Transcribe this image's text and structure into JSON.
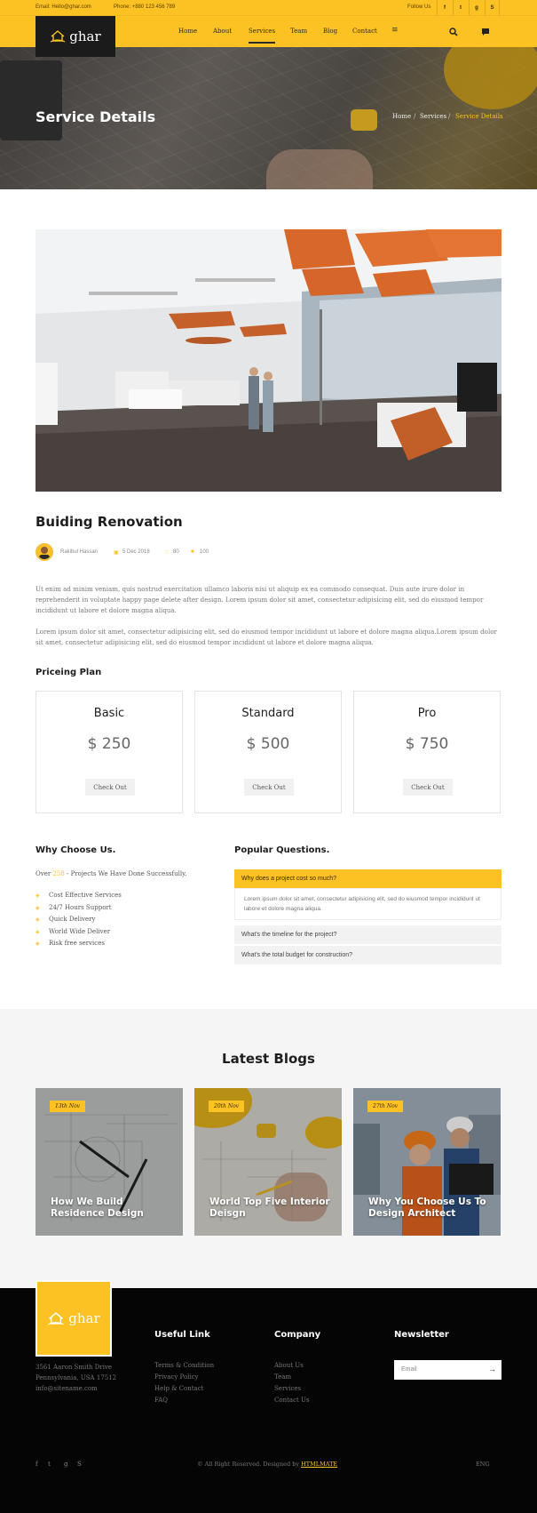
{
  "topbar": {
    "email": "Email: Hello@ghar.com",
    "phone": "Phone: +880 123 456 789",
    "follow": "Follow Us",
    "social": [
      {
        "icon": "facebook-icon",
        "glyph": "f"
      },
      {
        "icon": "twitter-icon",
        "glyph": "t"
      },
      {
        "icon": "google-plus-icon",
        "glyph": "g"
      },
      {
        "icon": "skype-icon",
        "glyph": "S"
      }
    ]
  },
  "nav": {
    "logo": "ghar",
    "items": [
      "Home",
      "About",
      "Services",
      "Team",
      "Blog",
      "Contact"
    ],
    "active": "Services",
    "menu_icon": "≡"
  },
  "hero": {
    "title": "Service Details",
    "breadcrumb": [
      "Home",
      "Services",
      "Service Details"
    ]
  },
  "article": {
    "title": "Buiding Renovation",
    "author": "Rakibul Hassan",
    "date": "5 Dec 2018",
    "likes": "80",
    "comments": "100",
    "para1": "Ut enim ad minim veniam, quis nostrud exercitation ullamco laboris nisi ut aliquip ex ea commodo consequat. Duis aute irure dolor in reprehenderit in voluptate happy page delete after design. Lorem ipsum dolor sit amet, consectetur adipisicing elit, sed do eiusmod tempor incididunt ut labore et dolore magna aliqua.",
    "para2": "Lorem ipsum dolor sit amet, consectetur adipisicing elit, sed do eiusmod tempor incididunt ut labore et dolore magna aliqua.Lorem ipsum dolor sit amet, consectetur adipisicing elit, sed do eiusmod tempor incididunt ut labore et dolore magna aliqua."
  },
  "pricing": {
    "title": "Priceing Plan",
    "plans": [
      {
        "name": "Basic",
        "price": "$ 250",
        "button": "Check Out"
      },
      {
        "name": "Standard",
        "price": "$ 500",
        "button": "Check Out"
      },
      {
        "name": "Pro",
        "price": "$ 750",
        "button": "Check Out"
      }
    ]
  },
  "why": {
    "title": "Why Choose Us.",
    "intro_pre": "Over ",
    "intro_num": "258",
    "intro_post": " - Projects We Have Done Successfully.",
    "items": [
      "Cost Effective Services",
      "24/7 Hours Support",
      "Quick Delivery",
      "World Wide Deliver",
      "Risk free services"
    ]
  },
  "faq": {
    "title": "Popular Questions.",
    "questions": [
      "Why does a project cost so much?",
      "What's the timeline for the project?",
      "What's the total budget for construction?"
    ],
    "answer": "Lorem ipsum dolor sit amet, consectetur adipisicing elit, sed do eiusmod tempor incididunt ut labore et dolore magna aliqua."
  },
  "blogs": {
    "title": "Latest Blogs",
    "posts": [
      {
        "date": "13th Nov",
        "title": "How We Build Residence Design"
      },
      {
        "date": "20th Nov",
        "title": "World Top Five Interior Deisgn"
      },
      {
        "date": "27th Nov",
        "title": "Why You Choose Us To Design Architect"
      }
    ]
  },
  "footer": {
    "logo": "ghar",
    "address": [
      "3561 Aaron Smith Drive",
      "Pennsylvania, USA 17512",
      "info@sitename.com"
    ],
    "useful_title": "Useful Link",
    "useful": [
      "Terms & Condition",
      "Privacy Policy",
      "Help & Contact",
      "FAQ"
    ],
    "company_title": "Company",
    "company": [
      "About Us",
      "Team",
      "Services",
      "Contact Us"
    ],
    "newsletter_title": "Newsletter",
    "email_placeholder": "Email",
    "copyright": "© All Right Reserved. Designed by ",
    "designer": "HTMLMATE",
    "lang": "ENG",
    "social": [
      "f",
      "t",
      "g",
      "S"
    ]
  },
  "colors": {
    "accent": "#fcc122",
    "dark": "#050505"
  }
}
